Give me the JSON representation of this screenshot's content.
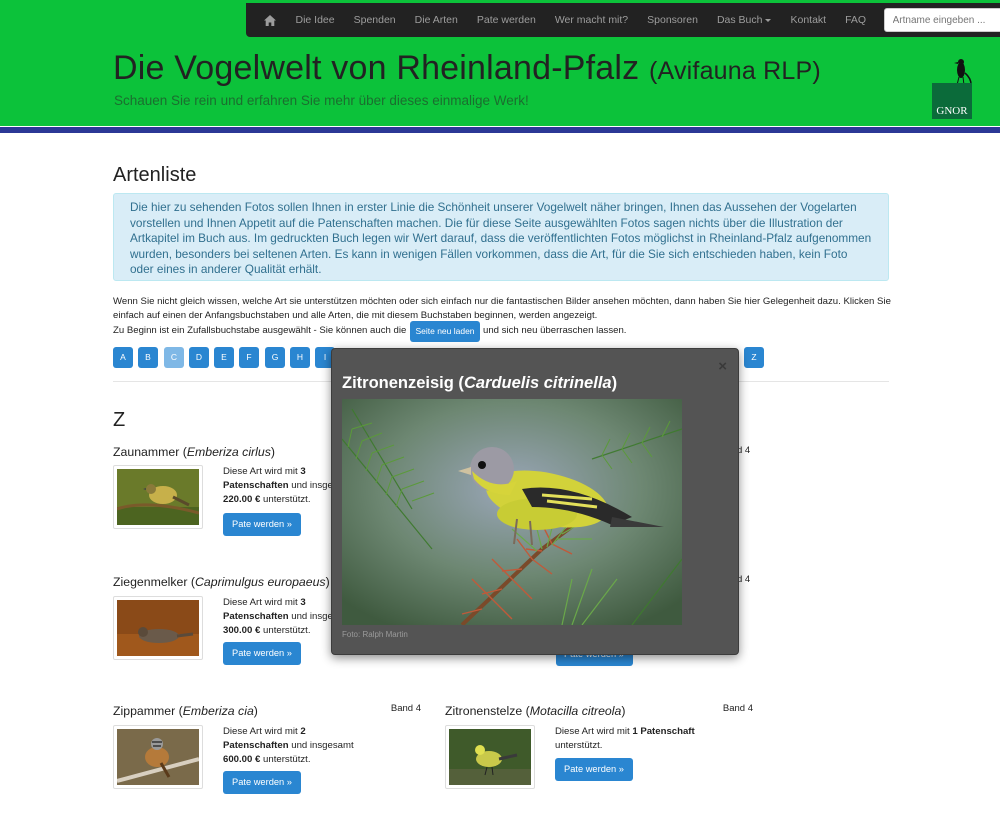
{
  "nav": {
    "items": [
      "Die Idee",
      "Spenden",
      "Die Arten",
      "Pate werden",
      "Wer macht mit?",
      "Sponsoren",
      "Das Buch",
      "Kontakt",
      "FAQ"
    ],
    "search_placeholder": "Artname eingeben ..."
  },
  "header": {
    "title": "Die Vogelwelt von Rheinland-Pfalz",
    "title_suffix": "(Avifauna RLP)",
    "tagline": "Schauen Sie rein und erfahren Sie mehr über dieses einmalige Werk!",
    "logo_text": "GNOR",
    "colors": {
      "green": "#0cc23a",
      "blue_bar": "#2b3896"
    }
  },
  "main": {
    "heading": "Artenliste",
    "info": "Die hier zu sehenden Fotos sollen Ihnen in erster Linie die Schönheit unserer Vogelwelt näher bringen, Ihnen das Aussehen der Vogelarten vorstellen und Ihnen Appetit auf die Patenschaften machen. Die für diese Seite ausgewählten Fotos sagen nichts über die Illustration der Artkapitel im Buch aus. Im gedruckten Buch legen wir Wert darauf, dass die veröffentlichten Fotos möglichst in Rheinland-Pfalz aufgenommen wurden, besonders bei seltenen Arten. Es kann in wenigen Fällen vorkommen, dass die Art, für die Sie sich entschieden haben, kein Foto oder eines in anderer Qualität erhält.",
    "intro": "Wenn Sie nicht gleich wissen, welche Art sie unterstützen möchten oder sich einfach nur die fantastischen Bilder ansehen möchten, dann haben Sie hier Gelegenheit dazu. Klicken Sie einfach auf einen der Anfangsbuchstaben und alle Arten, die mit diesem Buchstaben beginnen, werden angezeigt.",
    "intro_lead": "Zu Beginn ist ein Zufallsbuchstabe ausgewählt - Sie können auch die",
    "reload_label": "Seite neu laden",
    "intro_tail": "und sich neu überraschen lassen.",
    "letters": [
      "A",
      "B",
      "C",
      "D",
      "E",
      "F",
      "G",
      "H",
      "I"
    ],
    "letter_z": "Z",
    "section_letter": "Z",
    "cards": [
      {
        "name": "Zaunammer",
        "latin": "Emberiza cirlus",
        "line1": "Diese Art wird mit",
        "count": "3",
        "line2": "Patenschaften",
        "line2b": " und insgesamt",
        "amount": "220.00 €",
        "line3": " unterstützt.",
        "button": "Pate werden »"
      },
      {
        "name": "Ziegenmelker",
        "latin": "Caprimulgus europaeus",
        "line1": "Diese Art wird mit",
        "count": "3",
        "line2": "Patenschaften",
        "line2b": " und insgesamt",
        "amount": "300.00 €",
        "line3": " unterstützt.",
        "button": "Pate werden »"
      },
      {
        "name": "Zippammer",
        "latin": "Emberiza cia",
        "band": "Band 4",
        "line1": "Diese Art wird mit",
        "count": "2",
        "line2": "Patenschaften",
        "line2b": " und insgesamt",
        "amount": "600.00 €",
        "line3": " unterstützt.",
        "button": "Pate werden »"
      },
      {
        "name": "Zitronenstelze",
        "latin": "Motacilla citreola",
        "band": "Band 4",
        "line1": "Diese Art wird mit",
        "count": "1 Patenschaft",
        "line3": "unterstützt.",
        "button": "Pate werden »"
      }
    ],
    "band_partial": "d 4",
    "ghost_button": "Pate werden »"
  },
  "modal": {
    "title": "Zitronenzeisig",
    "latin": "Carduelis citrinella",
    "credit": "Foto: Ralph Martin",
    "close": "×"
  }
}
